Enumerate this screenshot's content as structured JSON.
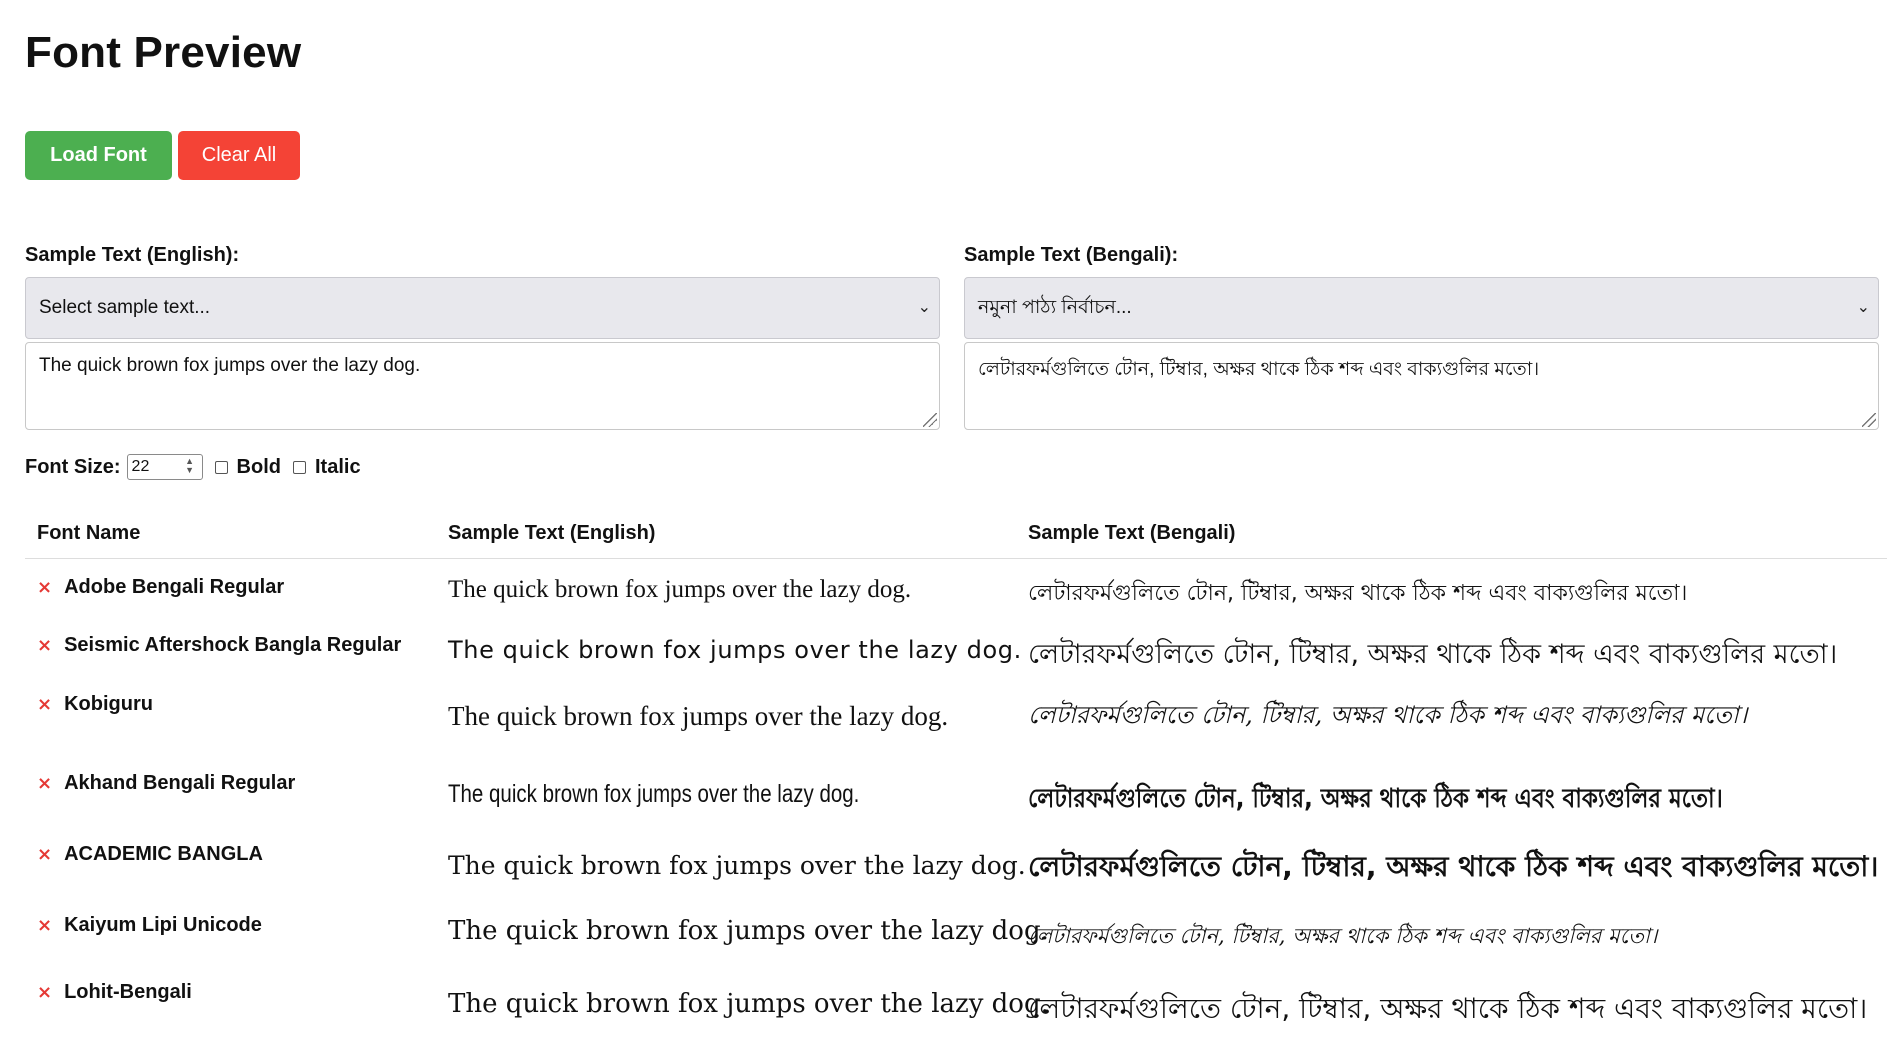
{
  "page": {
    "title": "Font Preview"
  },
  "toolbar": {
    "load_label": "Load Font",
    "clear_label": "Clear All"
  },
  "english": {
    "label": "Sample Text (English):",
    "select_value": "Select sample text...",
    "text": "The quick brown fox jumps over the lazy dog."
  },
  "bengali": {
    "label": "Sample Text (Bengali):",
    "select_value": "নমুনা পাঠ্য নির্বাচন...",
    "text": "লেটারফর্মগুলিতে টোন, টিম্বার, অক্ষর থাকে ঠিক শব্দ এবং বাক্যগুলির মতো।"
  },
  "controls": {
    "font_size_label": "Font Size:",
    "font_size_value": "22",
    "bold_label": "Bold",
    "italic_label": "Italic",
    "bold_checked": false,
    "italic_checked": false
  },
  "table": {
    "headers": {
      "name": "Font Name",
      "english": "Sample Text (English)",
      "bengali": "Sample Text (Bengali)"
    },
    "remove_glyph": "×",
    "rows": [
      {
        "name": "Adobe Bengali Regular"
      },
      {
        "name": "Seismic Aftershock Bangla Regular"
      },
      {
        "name": "Kobiguru"
      },
      {
        "name": "Akhand Bengali Regular"
      },
      {
        "name": "ACADEMIC BANGLA"
      },
      {
        "name": "Kaiyum Lipi Unicode"
      },
      {
        "name": "Lohit-Bengali"
      }
    ]
  },
  "colors": {
    "load_button": "#4caf50",
    "clear_button": "#f44336",
    "remove_icon": "#e53935"
  }
}
